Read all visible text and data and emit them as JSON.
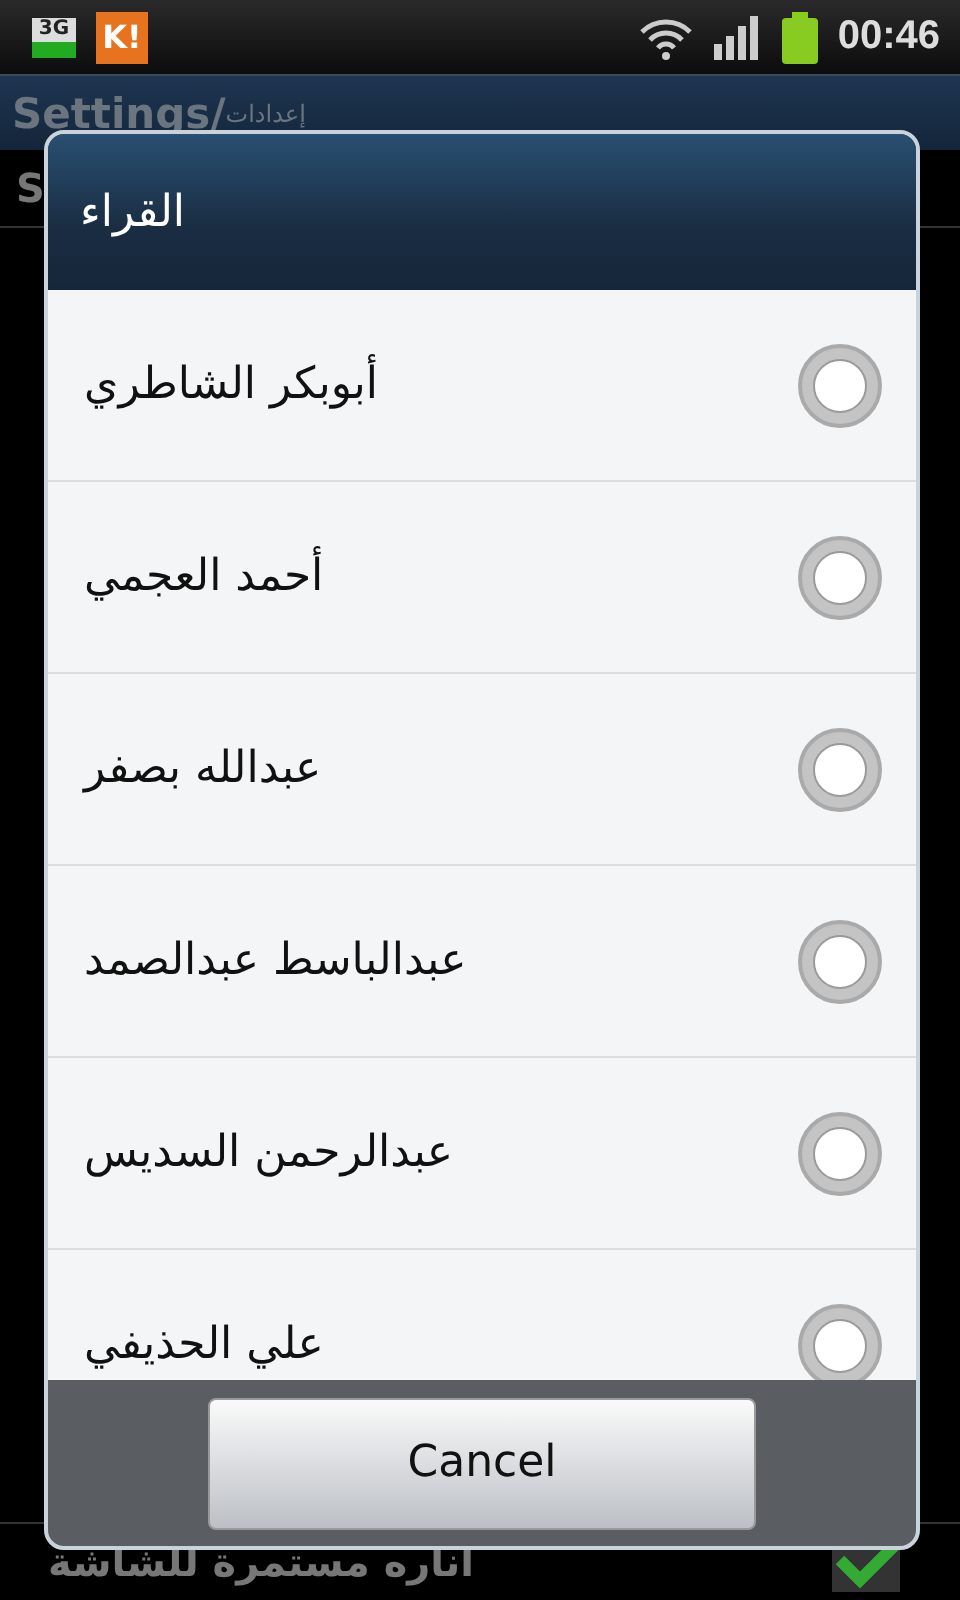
{
  "status_bar": {
    "network_label": "3G",
    "app_label": "K!",
    "time": "00:46"
  },
  "app_title": {
    "title": "Settings/",
    "subtitle": "إعدادات"
  },
  "background_rows": [
    {
      "kind": "label",
      "text": "S"
    },
    {
      "kind": "checkbox",
      "text": "اناره مستمرة للشاشة",
      "checked": true
    }
  ],
  "dialog": {
    "title": "القراء",
    "options": [
      {
        "label": "أبوبكر الشاطري",
        "selected": false
      },
      {
        "label": "أحمد العجمي",
        "selected": false
      },
      {
        "label": "عبدالله بصفر",
        "selected": false
      },
      {
        "label": "عبدالباسط عبدالصمد",
        "selected": false
      },
      {
        "label": "عبدالرحمن السديس",
        "selected": false
      },
      {
        "label": "علي الحذيفي",
        "selected": false
      }
    ],
    "button": "Cancel"
  }
}
